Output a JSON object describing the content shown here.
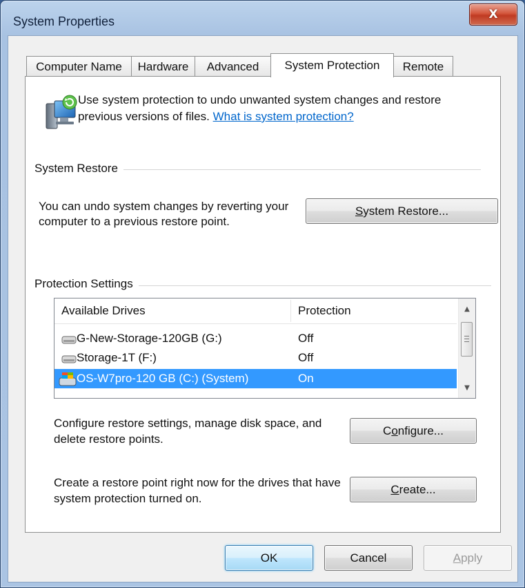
{
  "window": {
    "title": "System Properties",
    "close_label": "X"
  },
  "tabs": [
    {
      "label": "Computer Name",
      "active": false
    },
    {
      "label": "Hardware",
      "active": false
    },
    {
      "label": "Advanced",
      "active": false
    },
    {
      "label": "System Protection",
      "active": true
    },
    {
      "label": "Remote",
      "active": false
    }
  ],
  "intro": {
    "text": "Use system protection to undo unwanted system changes and restore previous versions of files.",
    "link": "What is system protection?",
    "icon": "system-protection-icon"
  },
  "system_restore": {
    "group_label": "System Restore",
    "description": "You can undo system changes by reverting your computer to a previous restore point.",
    "button": {
      "mnemonic": "S",
      "rest": "ystem Restore..."
    }
  },
  "protection": {
    "group_label": "Protection Settings",
    "columns": [
      "Available Drives",
      "Protection"
    ],
    "drives": [
      {
        "name": "G-New-Storage-120GB (G:)",
        "protection": "Off",
        "selected": false,
        "icon": "hard-drive-icon"
      },
      {
        "name": "Storage-1T (F:)",
        "protection": "Off",
        "selected": false,
        "icon": "hard-drive-icon"
      },
      {
        "name": "OS-W7pro-120 GB (C:) (System)",
        "protection": "On",
        "selected": true,
        "icon": "system-drive-icon"
      }
    ],
    "configure_text": "Configure restore settings, manage disk space, and delete restore points.",
    "configure_button": {
      "before": "C",
      "mnemonic": "o",
      "rest": "nfigure..."
    },
    "create_text": "Create a restore point right now for the drives that have system protection turned on.",
    "create_button": {
      "mnemonic": "C",
      "rest": "reate..."
    }
  },
  "footer": {
    "ok": "OK",
    "cancel": "Cancel",
    "apply": {
      "mnemonic": "A",
      "rest": "pply"
    }
  },
  "colors": {
    "selection": "#3399ff",
    "link": "#0066cc",
    "frame": "#aac4e3"
  }
}
